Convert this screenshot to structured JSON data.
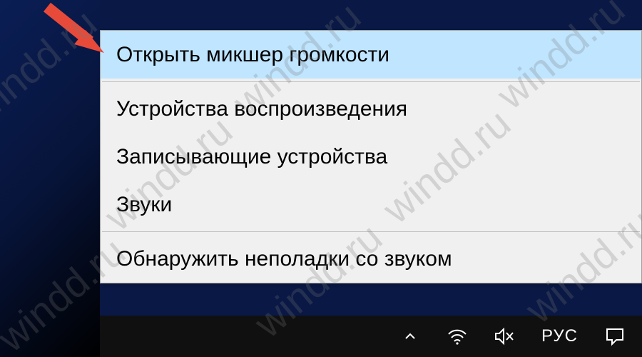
{
  "menu": {
    "items": [
      {
        "label": "Открыть микшер громкости",
        "highlighted": true
      },
      {
        "label": "Устройства воспроизведения",
        "highlighted": false
      },
      {
        "label": "Записывающие устройства",
        "highlighted": false
      },
      {
        "label": "Звуки",
        "highlighted": false
      },
      {
        "label": "Обнаружить неполадки со звуком",
        "highlighted": false
      }
    ]
  },
  "taskbar": {
    "language": "РУС"
  },
  "watermark": "windd.ru",
  "annotation": {
    "arrow_color": "#e84a3a"
  },
  "colors": {
    "menu_highlight": "#bfe5ff",
    "taskbar_bg": "#101010"
  }
}
